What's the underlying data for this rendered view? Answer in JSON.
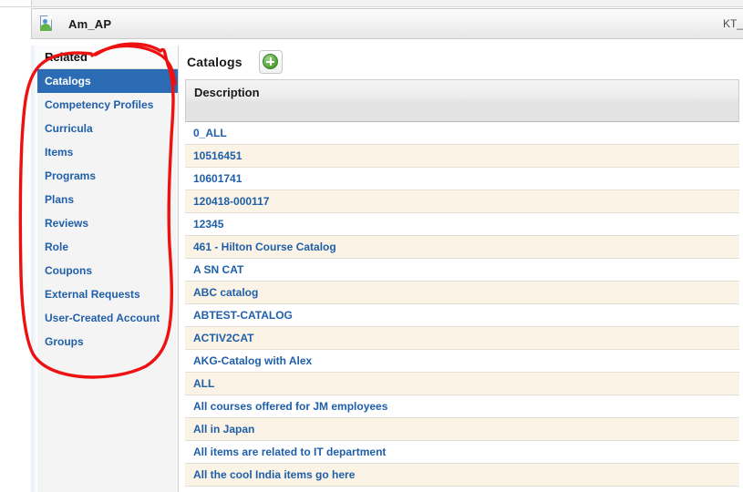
{
  "window": {
    "entity_icon": "user-document-icon",
    "title": "Am_AP",
    "right_label": "KT_"
  },
  "sidebar": {
    "header": "Related",
    "items": [
      {
        "label": "Catalogs",
        "selected": true
      },
      {
        "label": "Competency Profiles",
        "selected": false
      },
      {
        "label": "Curricula",
        "selected": false
      },
      {
        "label": "Items",
        "selected": false
      },
      {
        "label": "Programs",
        "selected": false
      },
      {
        "label": "Plans",
        "selected": false
      },
      {
        "label": "Reviews",
        "selected": false
      },
      {
        "label": "Role",
        "selected": false
      },
      {
        "label": "Coupons",
        "selected": false
      },
      {
        "label": "External Requests",
        "selected": false
      },
      {
        "label": "User-Created Account",
        "selected": false
      },
      {
        "label": "Groups",
        "selected": false
      }
    ]
  },
  "main": {
    "panel_title": "Catalogs",
    "add_button_icon": "plus-circle-icon",
    "table": {
      "columns": [
        "Description"
      ],
      "rows": [
        "0_ALL",
        "10516451",
        "10601741",
        "120418-000117",
        "12345",
        "461 - Hilton Course Catalog",
        "A SN CAT",
        "ABC catalog",
        "ABTEST-CATALOG",
        "ACTIV2CAT",
        "AKG-Catalog with Alex",
        "ALL",
        "All courses offered for JM employees",
        "All in Japan",
        "All items are related to IT department",
        "All the cool India items go here"
      ]
    }
  },
  "annotation": {
    "shape": "red-oval-highlight",
    "color": "#ee1111",
    "target": "sidebar-related-list"
  },
  "colors": {
    "selected_item_bg": "#2b6cb5",
    "link_text": "#1f5fa9",
    "row_alt_bg": "#faf3e6",
    "annotation_red": "#ee1111"
  }
}
